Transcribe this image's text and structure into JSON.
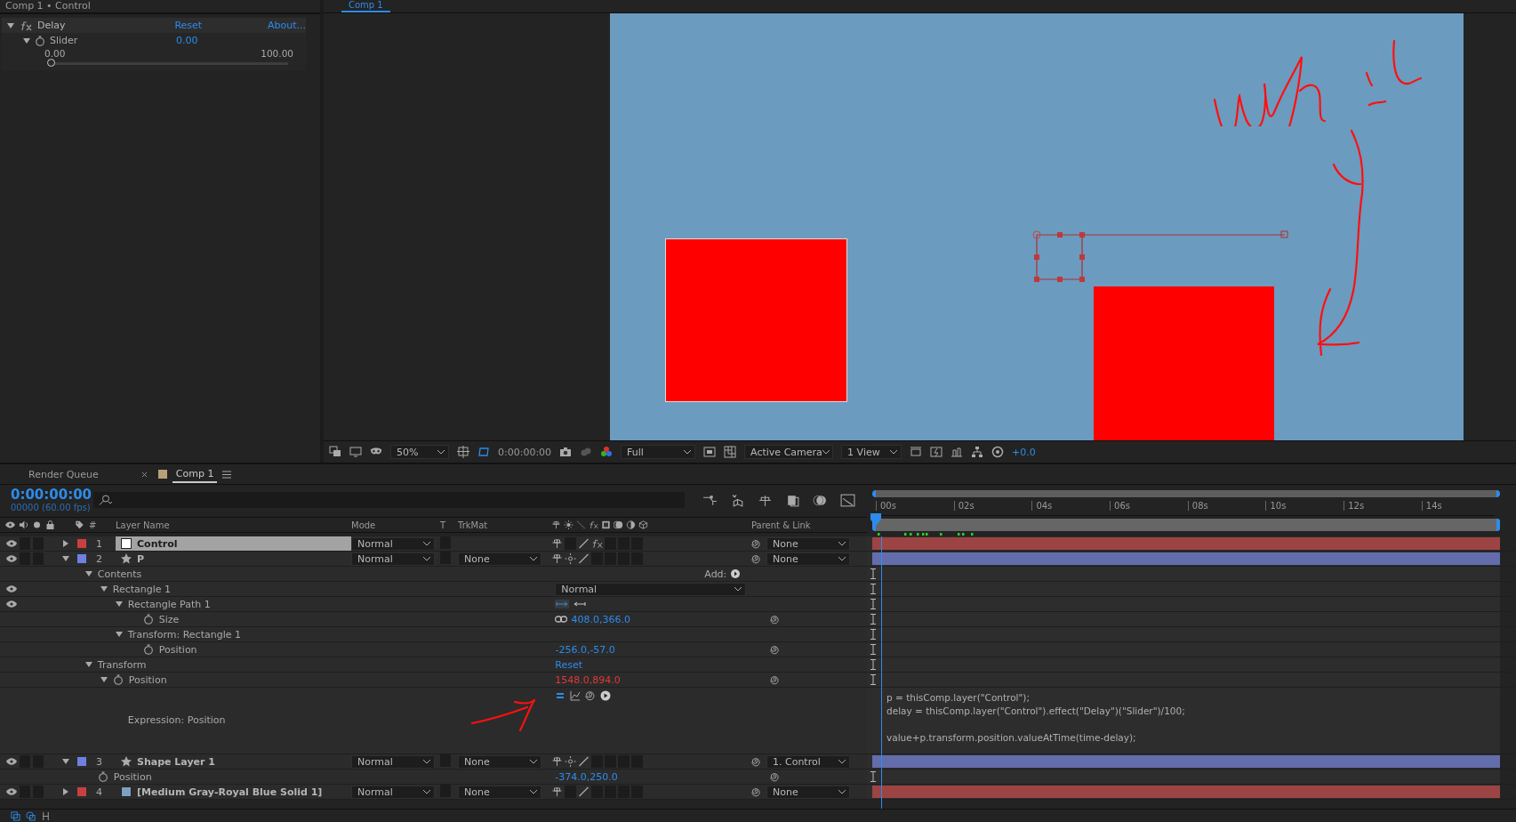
{
  "effect_controls": {
    "title": "Comp 1 • Control",
    "effect": {
      "name": "Delay",
      "expanded": true,
      "reset": "Reset",
      "about": "About...",
      "property": {
        "name": "Slider",
        "expanded": true,
        "value": "0.00",
        "min": "0.00",
        "max": "100.00",
        "level": 0
      }
    }
  },
  "viewer": {
    "tab": "Comp 1",
    "toolbar": {
      "zoom": "50%",
      "timecode": "0:00:00:00",
      "resolution": "Full",
      "camera": "Active Camera",
      "views": "1 View",
      "exposure": "+0.0"
    }
  },
  "timeline": {
    "tabs": [
      {
        "label": "Render Queue",
        "selected": false
      },
      {
        "label": "Comp 1",
        "selected": true
      }
    ],
    "timecode": "0:00:00:00",
    "frame_info": "00000 (60.00 fps)",
    "columns": {
      "number": "#",
      "layer_name": "Layer Name",
      "mode": "Mode",
      "track": "T",
      "trkmat": "TrkMat",
      "parent": "Parent & Link"
    },
    "ruler": [
      "00s",
      "02s",
      "04s",
      "06s",
      "08s",
      "10s",
      "12s",
      "14s"
    ],
    "layers": [
      {
        "number": "1",
        "name": "Control",
        "kind": "solid",
        "color": "#c8403f",
        "source": {
          "color": "#ffffff"
        },
        "visible": true,
        "selected": true,
        "expanded": false,
        "mode": "Normal",
        "parent": "None",
        "fx": true
      },
      {
        "number": "2",
        "name": "P",
        "kind": "shape",
        "color": "#7080e0",
        "visible": true,
        "selected": false,
        "expanded": true,
        "mode": "Normal",
        "trkmat": "None",
        "parent": "None",
        "fx": false,
        "children": [
          {
            "name": "Contents",
            "kind": "group",
            "expanded": true,
            "add_label": "Add:",
            "children": [
              {
                "name": "Rectangle 1",
                "kind": "group",
                "expanded": true,
                "visible": true,
                "blend_mode": "Normal",
                "children": [
                  {
                    "name": "Rectangle Path 1",
                    "kind": "group",
                    "expanded": true,
                    "visible": true,
                    "path_direction": true,
                    "children": [
                      {
                        "name": "Size",
                        "kind": "property",
                        "value": "408.0,366.0",
                        "linked": true,
                        "expression": false
                      }
                    ]
                  },
                  {
                    "name": "Transform: Rectangle 1",
                    "kind": "group",
                    "expanded": true,
                    "children": [
                      {
                        "name": "Position",
                        "kind": "property",
                        "value": "-256.0,-57.0",
                        "expression": false
                      }
                    ]
                  }
                ]
              }
            ]
          },
          {
            "name": "Transform",
            "kind": "group",
            "expanded": true,
            "reset": "Reset",
            "children": [
              {
                "name": "Position",
                "kind": "property",
                "value": "1548.0,894.0",
                "expression": true,
                "expanded": true,
                "children": [
                  {
                    "name": "Expression: Position",
                    "kind": "expression",
                    "code": "p = thisComp.layer(\"Control\");\ndelay = thisComp.layer(\"Control\").effect(\"Delay\")(\"Slider\")/100;\n\nvalue+p.transform.position.valueAtTime(time-delay);"
                  }
                ]
              }
            ]
          }
        ]
      },
      {
        "number": "3",
        "name": "Shape Layer 1",
        "kind": "shape",
        "color": "#7080e0",
        "visible": true,
        "selected": false,
        "expanded": true,
        "mode": "Normal",
        "trkmat": "None",
        "parent": "1. Control",
        "fx": false,
        "children": [
          {
            "name": "Position",
            "kind": "property",
            "value": "-374.0,250.0",
            "expression": false
          }
        ]
      },
      {
        "number": "4",
        "name": "[Medium Gray-Royal Blue Solid 1]",
        "kind": "solid",
        "color": "#c8403f",
        "source": {
          "color": "#7ea0c0"
        },
        "visible": true,
        "selected": false,
        "expanded": false,
        "mode": "Normal",
        "trkmat": "None",
        "parent": "None",
        "fx": false
      }
    ]
  }
}
